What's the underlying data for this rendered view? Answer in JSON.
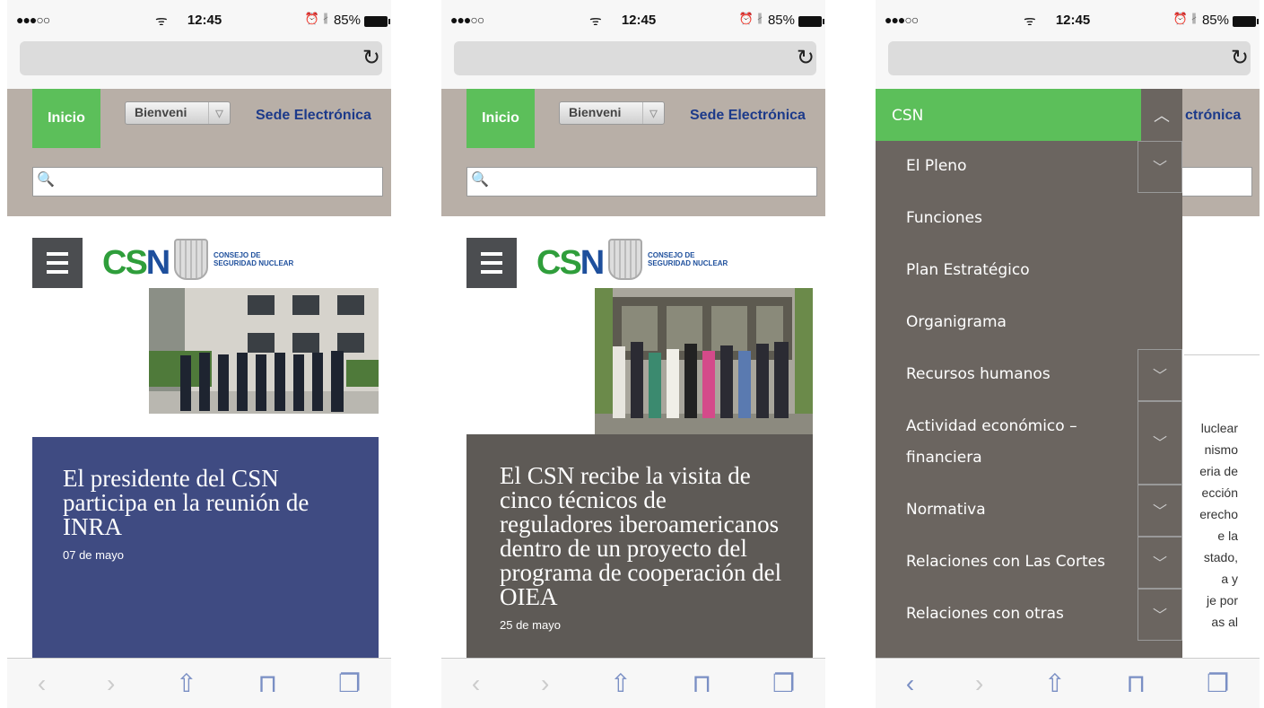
{
  "status": {
    "signal": "●●●○○",
    "wifi": "ᯤ",
    "time": "12:45",
    "alarm": "⏰",
    "bluetooth": "∦",
    "battery": "85%"
  },
  "nav": {
    "inicio": "Inicio",
    "lang": "Bienveni",
    "sede": "Sede Electrónica",
    "reload_icon": "reload-icon"
  },
  "logo": {
    "csn_a": "CS",
    "csn_b": "N",
    "sub1": "CONSEJO DE",
    "sub2": "SEGURIDAD NUCLEAR"
  },
  "cards": [
    {
      "title": "El presidente del CSN participa en la reunión de INRA",
      "date": "07 de mayo",
      "color": "#3f4b82"
    },
    {
      "title": "El CSN recibe la visita de cinco técnicos de reguladores iberoamericanos dentro de un proyecto del programa de cooperación del OIEA",
      "date": "25 de mayo",
      "color": "#5e5a56"
    }
  ],
  "menu": {
    "header": "CSN",
    "items": [
      {
        "label": "El Pleno",
        "expandable": true
      },
      {
        "label": "Funciones",
        "expandable": false
      },
      {
        "label": "Plan Estratégico",
        "expandable": false
      },
      {
        "label": "Organigrama",
        "expandable": false
      },
      {
        "label": "Recursos humanos",
        "expandable": true
      },
      {
        "label": "Actividad económico – financiera",
        "expandable": true
      },
      {
        "label": "Normativa",
        "expandable": true
      },
      {
        "label": "Relaciones con Las Cortes",
        "expandable": true
      },
      {
        "label": "Relaciones con otras",
        "expandable": true
      }
    ]
  },
  "background_text": {
    "sede_partial": "ctrónica",
    "lines": [
      "luclear",
      "nismo",
      "eria de",
      "ección",
      "erecho",
      "e   la",
      "stado,",
      "a    y",
      "je por",
      "as  al"
    ]
  },
  "toolbar": {
    "back": "‹",
    "forward": "›",
    "share": "⇧",
    "bookmarks": "📖",
    "tabs": "❐"
  }
}
